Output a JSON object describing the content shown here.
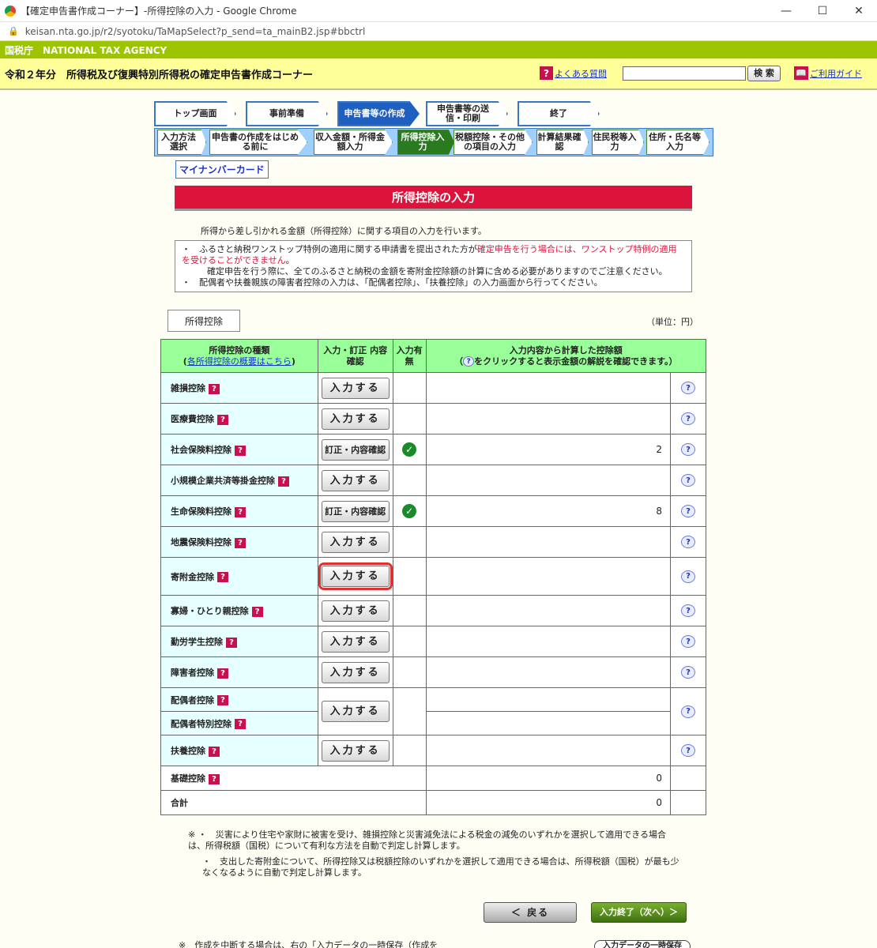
{
  "browser": {
    "window_title": "【確定申告書作成コーナー】-所得控除の入力 - Google Chrome",
    "url": "keisan.nta.go.jp/r2/syotoku/TaMapSelect?p_send=ta_mainB2.jsp#bbctrl"
  },
  "header": {
    "agency": "国税庁　NATIONAL TAX AGENCY",
    "title": "令和２年分　所得税及び復興特別所得税の確定申告書作成コーナー",
    "faq_label": "よくある質問",
    "search_label": "検 索",
    "guide_label": "ご利用ガイド"
  },
  "steps": [
    "トップ画面",
    "事前準備",
    "申告書等の作成",
    "申告書等の送信・印刷",
    "終了"
  ],
  "substeps": [
    "入力方法選択",
    "申告書の作成をはじめる前に",
    "収入金額・所得金額入力",
    "所得控除入力",
    "税額控除・その他の項目の入力",
    "計算結果確認",
    "住民税等入力",
    "住所・氏名等入力"
  ],
  "mynumber_label": "マイナンバーカード",
  "section_title": "所得控除の入力",
  "description": "所得から差し引かれる金額（所得控除）に関する項目の入力を行います。",
  "notes": {
    "n1_a": "・　ふるさと納税ワンストップ特例の適用に関する申請書を提出された方が",
    "n1_red": "確定申告を行う場合には、ワンストップ特例の適用を受けることができません",
    "n1_b": "。",
    "n1_c": "確定申告を行う際に、全てのふるさと納税の金額を寄附金控除額の計算に含める必要がありますのでご注意ください。",
    "n2": "・　配偶者や扶養親族の障害者控除の入力は、「配偶者控除」、「扶養控除」の入力画面から行ってください。"
  },
  "tab_label": "所得控除",
  "unit_label": "（単位：円）",
  "table": {
    "header": {
      "col1": "所得控除の種類",
      "col1_link": "各所得控除の概要はこちら",
      "col2": "入力・訂正 内容確認",
      "col3": "入力有無",
      "col4_line1": "入力内容から計算した控除額",
      "col4_line2": "をクリックすると表示金額の解説を確認できます。"
    },
    "btn_input": "入力する",
    "btn_edit": "訂正・内容確認",
    "rows": {
      "r1": {
        "name": "雑損控除"
      },
      "r2": {
        "name": "医療費控除"
      },
      "r3": {
        "name": "社会保険料控除",
        "amount": "2"
      },
      "r4": {
        "name": "小規模企業共済等掛金控除"
      },
      "r5": {
        "name": "生命保険料控除",
        "amount": "8"
      },
      "r6": {
        "name": "地震保険料控除"
      },
      "r7": {
        "name": "寄附金控除"
      },
      "r8": {
        "name": "寡婦・ひとり親控除"
      },
      "r9": {
        "name": "勤労学生控除"
      },
      "r10": {
        "name": "障害者控除"
      },
      "r11a": {
        "name": "配偶者控除"
      },
      "r11b": {
        "name": "配偶者特別控除"
      },
      "r12": {
        "name": "扶養控除"
      },
      "r13": {
        "name": "基礎控除",
        "amount": "0"
      },
      "r14": {
        "name": "合計",
        "amount": "0"
      }
    }
  },
  "footnotes": {
    "f1": "※ ・　災害により住宅や家財に被害を受け、雑損控除と災害減免法による税金の減免のいずれかを選択して適用できる場合は、所得税額（国税）について有利な方法を自動で判定し計算します。",
    "f2": "・　支出した寄附金について、所得控除又は税額控除のいずれかを選択して適用できる場合は、所得税額（国税）が最も少なくなるように自動で判定し計算します。"
  },
  "nav": {
    "back": "＜ 戻る",
    "finish": "入力終了（次へ）＞"
  },
  "bottom_note": "※　作成を中断する場合は、右の「入力データの一時保存（作成を",
  "save_btn": "入力データの一時保存"
}
